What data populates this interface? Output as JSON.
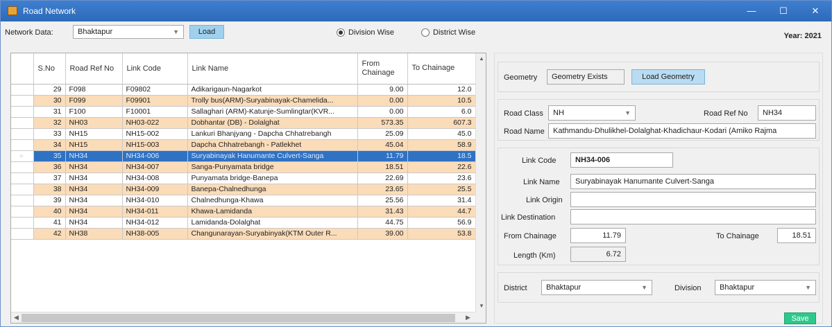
{
  "window": {
    "title": "Road Network",
    "minimize": "—",
    "maximize": "☐",
    "close": "✕"
  },
  "toolbar": {
    "network_label": "Network Data:",
    "network_value": "Bhaktapur",
    "load_label": "Load",
    "radio_division": "Division Wise",
    "radio_district": "District Wise",
    "year": "Year: 2021"
  },
  "grid": {
    "headers": [
      "S.No",
      "Road Ref No",
      "Link Code",
      "Link Name",
      "From Chainage",
      "To Chainage"
    ],
    "rows": [
      [
        "29",
        "F098",
        "F09802",
        "Adikarigaun-Nagarkot",
        "9.00",
        "12.0"
      ],
      [
        "30",
        "F099",
        "F09901",
        "Trolly bus(ARM)-Suryabinayak-Chamelida...",
        "0.00",
        "10.5"
      ],
      [
        "31",
        "F100",
        "F10001",
        "Sallaghari (ARM)-Katunje-Sumlingtar(KVR...",
        "0.00",
        "6.0"
      ],
      [
        "32",
        "NH03",
        "NH03-022",
        "Dobhantar (DB) - Dolalghat",
        "573.35",
        "607.3"
      ],
      [
        "33",
        "NH15",
        "NH15-002",
        "Lankuri Bhanjyang - Dapcha Chhatrebangh",
        "25.09",
        "45.0"
      ],
      [
        "34",
        "NH15",
        "NH15-003",
        "Dapcha Chhatrebangh - Patlekhet",
        "45.04",
        "58.9"
      ],
      [
        "35",
        "NH34",
        "NH34-006",
        "Suryabinayak Hanumante Culvert-Sanga",
        "11.79",
        "18.5"
      ],
      [
        "36",
        "NH34",
        "NH34-007",
        "Sanga-Punyamata bridge",
        "18.51",
        "22.6"
      ],
      [
        "37",
        "NH34",
        "NH34-008",
        "Punyamata bridge-Banepa",
        "22.69",
        "23.6"
      ],
      [
        "38",
        "NH34",
        "NH34-009",
        "Banepa-Chalnedhunga",
        "23.65",
        "25.5"
      ],
      [
        "39",
        "NH34",
        "NH34-010",
        "Chalnedhunga-Khawa",
        "25.56",
        "31.4"
      ],
      [
        "40",
        "NH34",
        "NH34-011",
        "Khawa-Lamidanda",
        "31.43",
        "44.7"
      ],
      [
        "41",
        "NH34",
        "NH34-012",
        "Lamidanda-Dolalghat",
        "44.75",
        "56.9"
      ],
      [
        "42",
        "NH38",
        "NH38-005",
        "Changunarayan-Suryabinyak(KTM Outer R...",
        "39.00",
        "53.8"
      ]
    ],
    "selected_index": 6,
    "row_pointer": "▸"
  },
  "detail": {
    "geometry_label": "Geometry",
    "geometry_status": "Geometry Exists",
    "load_geometry": "Load Geometry",
    "road_class_label": "Road Class",
    "road_class_value": "NH",
    "road_ref_label": "Road Ref No",
    "road_ref_value": "NH34",
    "road_name_label": "Road Name",
    "road_name_value": "Kathmandu-Dhulikhel-Dolalghat-Khadichaur-Kodari (Amiko Rajma",
    "link_code_label": "Link Code",
    "link_code_value": "NH34-006",
    "link_name_label": "Link Name",
    "link_name_value": "Suryabinayak Hanumante Culvert-Sanga",
    "link_origin_label": "Link Origin",
    "link_origin_value": "",
    "link_dest_label": "Link Destination",
    "link_dest_value": "",
    "from_chainage_label": "From Chainage",
    "from_chainage_value": "11.79",
    "to_chainage_label": "To Chainage",
    "to_chainage_value": "18.51",
    "length_label": "Length (Km)",
    "length_value": "6.72",
    "district_label": "District",
    "district_value": "Bhaktapur",
    "division_label": "Division",
    "division_value": "Bhaktapur",
    "save_label": "Save"
  }
}
